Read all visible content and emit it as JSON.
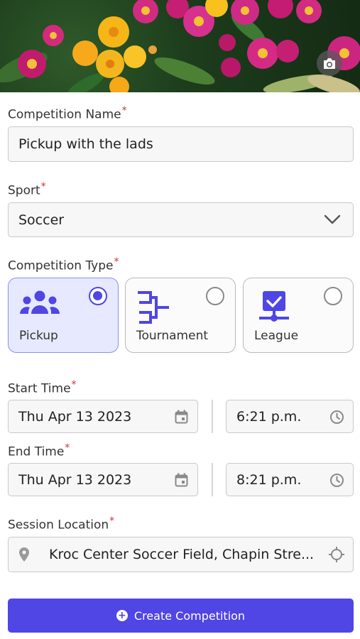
{
  "form": {
    "competition_name": {
      "label": "Competition Name",
      "required": "*",
      "value": "Pickup with the lads"
    },
    "sport": {
      "label": "Sport",
      "required": "*",
      "value": "Soccer"
    },
    "competition_type": {
      "label": "Competition Type",
      "required": "*",
      "options": [
        {
          "label": "Pickup",
          "selected": true,
          "icon": "group-icon"
        },
        {
          "label": "Tournament",
          "selected": false,
          "icon": "bracket-icon"
        },
        {
          "label": "League",
          "selected": false,
          "icon": "league-icon"
        }
      ]
    },
    "start_time": {
      "label": "Start Time",
      "required": "*",
      "date": "Thu Apr 13 2023",
      "time": "6:21 p.m."
    },
    "end_time": {
      "label": "End Time",
      "required": "*",
      "date": "Thu Apr 13 2023",
      "time": "8:21 p.m."
    },
    "session_location": {
      "label": "Session Location",
      "required": "*",
      "value": "Kroc Center Soccer Field, Chapin Stre..."
    }
  },
  "actions": {
    "create_label": "Create Competition",
    "create_icon": "plus-circle-icon"
  },
  "colors": {
    "accent": "#4f46e5",
    "selected_bg": "#e6e9ff",
    "required": "#d0303a"
  }
}
